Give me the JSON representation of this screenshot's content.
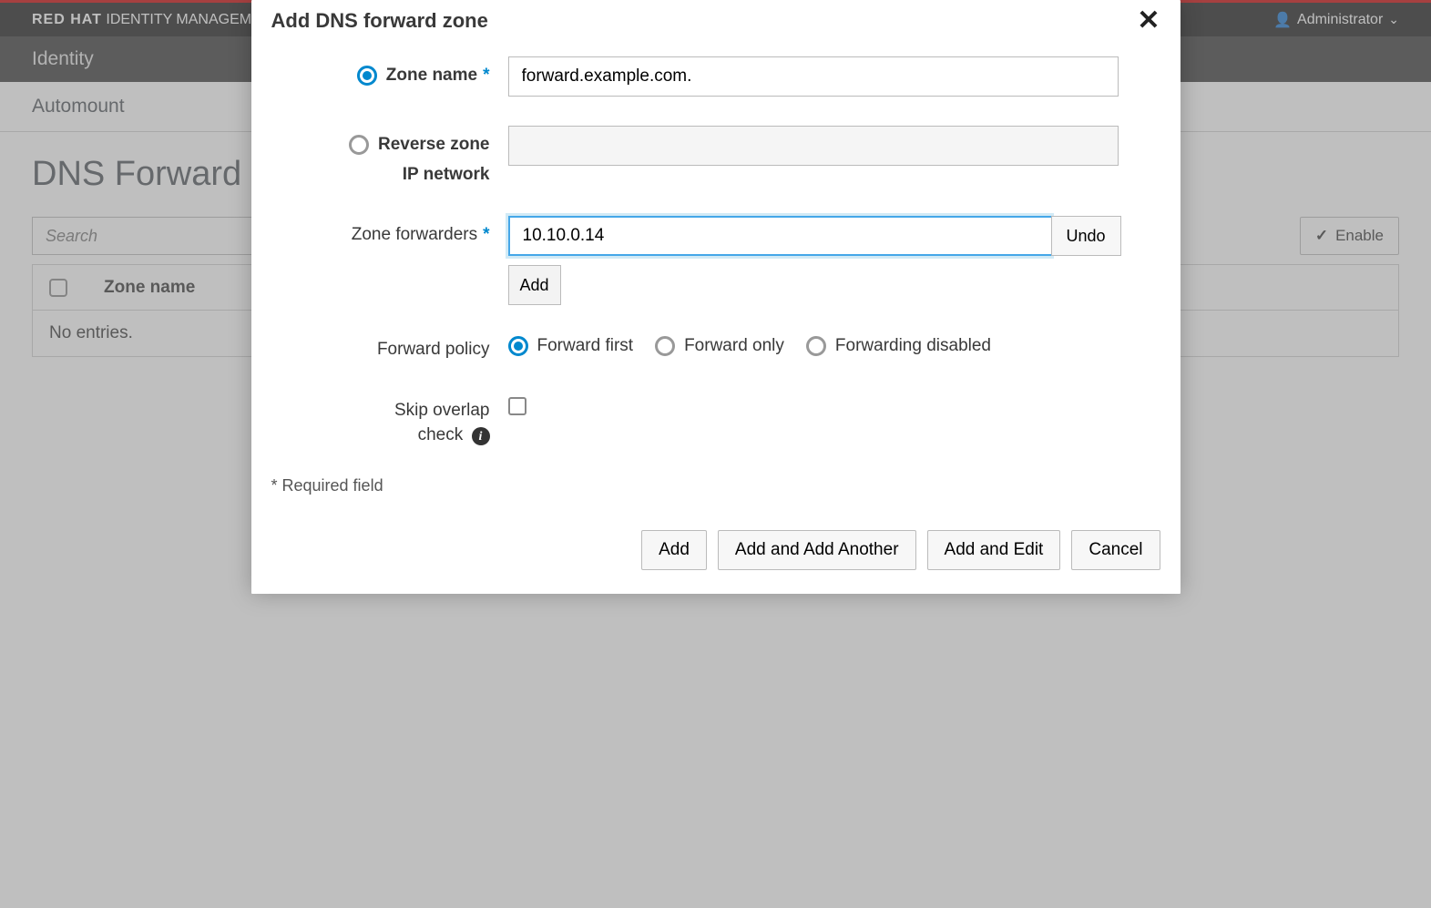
{
  "header": {
    "brand_bold": "RED HAT",
    "brand_rest": " IDENTITY MANAGEMENT",
    "user": "Administrator"
  },
  "nav": {
    "item": "Identity"
  },
  "tabs": {
    "item": "Automount"
  },
  "page": {
    "title": "DNS Forward Zones",
    "search_placeholder": "Search",
    "enable_btn": "Enable",
    "col_zone": "Zone name",
    "no_entries": "No entries."
  },
  "modal": {
    "title": "Add DNS forward zone",
    "zone_name_label": "Zone name",
    "zone_name_value": "forward.example.com.",
    "reverse_label_l1": "Reverse zone",
    "reverse_label_l2": "IP network",
    "forwarders_label": "Zone forwarders",
    "forwarder_value": "10.10.0.14",
    "undo": "Undo",
    "add_forwarder": "Add",
    "policy_label": "Forward policy",
    "policy_opts": [
      "Forward first",
      "Forward only",
      "Forwarding disabled"
    ],
    "skip_label_l1": "Skip overlap",
    "skip_label_l2": "check",
    "required_note": "* Required field",
    "btns": {
      "add": "Add",
      "add_another": "Add and Add Another",
      "add_edit": "Add and Edit",
      "cancel": "Cancel"
    }
  }
}
